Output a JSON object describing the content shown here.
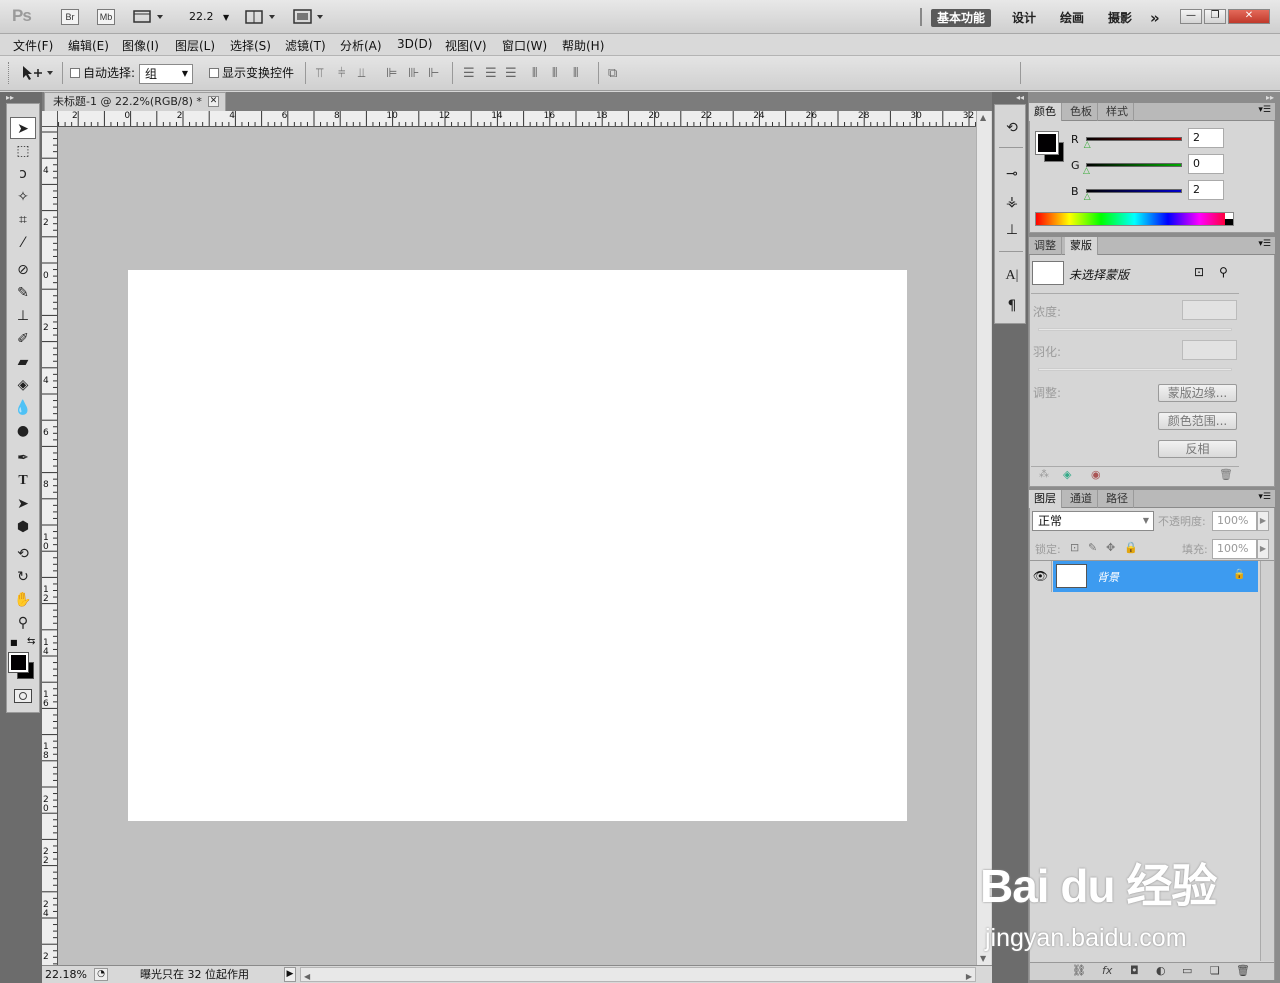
{
  "app": {
    "logo": "Ps",
    "bridge": "Br",
    "minibridge": "Mb",
    "zoom": "22.2",
    "workspaces": [
      "基本功能",
      "设计",
      "绘画",
      "摄影"
    ],
    "more": "»"
  },
  "menu": [
    "文件(F)",
    "编辑(E)",
    "图像(I)",
    "图层(L)",
    "选择(S)",
    "滤镜(T)",
    "分析(A)",
    "3D(D)",
    "视图(V)",
    "窗口(W)",
    "帮助(H)"
  ],
  "options": {
    "auto_select_label": "自动选择:",
    "auto_select_value": "组",
    "show_transform_label": "显示变换控件"
  },
  "document": {
    "tab_title": "未标题-1 @ 22.2%(RGB/8) *",
    "hruler_ticks": [
      "2",
      "0",
      "2",
      "4",
      "6",
      "8",
      "10",
      "12",
      "14",
      "16",
      "18",
      "20",
      "22",
      "24",
      "26",
      "28",
      "30",
      "32"
    ],
    "vruler_ticks": [
      "4",
      "2",
      "0",
      "2",
      "4",
      "6",
      "8",
      "10",
      "12",
      "14",
      "16",
      "18",
      "20",
      "22",
      "24",
      "2"
    ]
  },
  "status": {
    "zoom": "22.18%",
    "info": "曝光只在 32 位起作用"
  },
  "color_panel": {
    "tabs": [
      "颜色",
      "色板",
      "样式"
    ],
    "channels": [
      {
        "label": "R",
        "value": "2",
        "color": "#cc0000"
      },
      {
        "label": "G",
        "value": "0",
        "color": "#00aa00"
      },
      {
        "label": "B",
        "value": "2",
        "color": "#0000cc"
      }
    ]
  },
  "masks_panel": {
    "tabs": [
      "调整",
      "蒙版"
    ],
    "no_mask": "未选择蒙版",
    "density_label": "浓度:",
    "feather_label": "羽化:",
    "refine_label": "调整:",
    "btn_mask_edge": "蒙版边缘...",
    "btn_color_range": "颜色范围...",
    "btn_invert": "反相"
  },
  "layers_panel": {
    "tabs": [
      "图层",
      "通道",
      "路径"
    ],
    "blend_mode": "正常",
    "opacity_label": "不透明度:",
    "opacity_value": "100%",
    "lock_label": "锁定:",
    "fill_label": "填充:",
    "fill_value": "100%",
    "layers": [
      {
        "name": "背景"
      }
    ]
  },
  "watermark": {
    "logo": "Bai du 经验",
    "url": "jingyan.baidu.com"
  },
  "colors": {
    "selected_layer": "#3d9bf0",
    "foreground": "#020002",
    "background": "#000000"
  }
}
